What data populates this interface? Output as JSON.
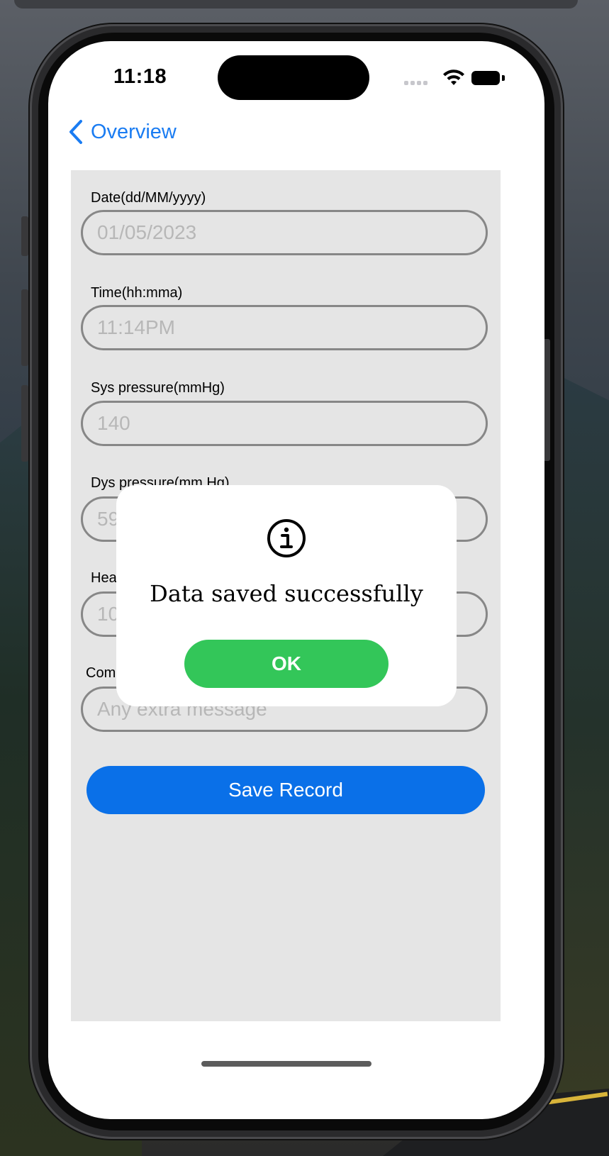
{
  "status_bar": {
    "time": "11:18"
  },
  "nav": {
    "back_label": "Overview"
  },
  "form": {
    "fields": [
      {
        "label": "Date(dd/MM/yyyy)",
        "value": "01/05/2023"
      },
      {
        "label": "Time(hh:mma)",
        "value": "11:14PM"
      },
      {
        "label": "Sys pressure(mmHg)",
        "value": "140"
      },
      {
        "label": "Dys pressure(mm Hg)",
        "value": "59"
      },
      {
        "label": "Hea",
        "value": "10"
      },
      {
        "label": "Com",
        "placeholder": "Any extra message"
      }
    ],
    "save_label": "Save Record"
  },
  "alert": {
    "icon": "info-icon",
    "message": "Data saved successfully",
    "ok_label": "OK"
  },
  "colors": {
    "accent": "#1a7cf2",
    "save_button": "#0a70e8",
    "ok_button": "#33c659",
    "form_background": "#e5e5e5"
  }
}
